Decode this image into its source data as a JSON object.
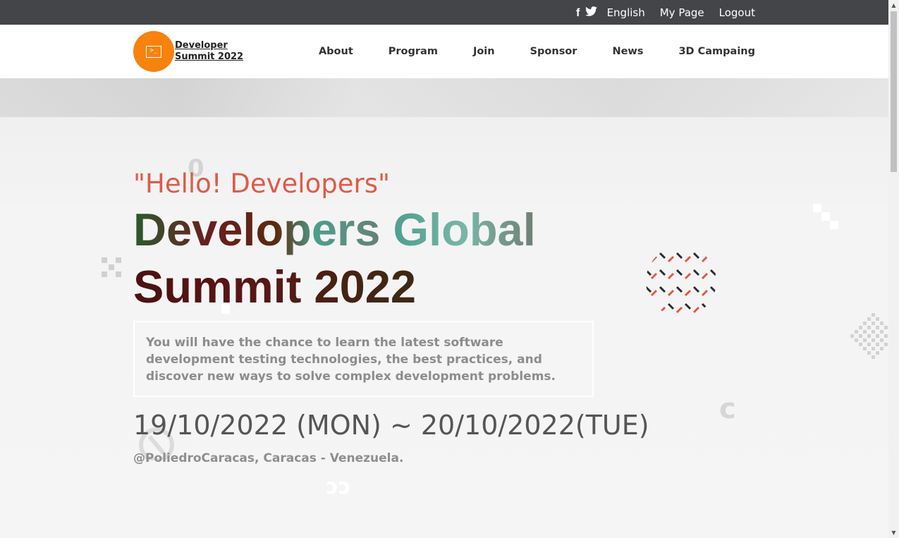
{
  "topbar": {
    "social_icons": [
      "facebook-icon",
      "twitter-icon"
    ],
    "facebook_glyph": "f",
    "twitter_glyph": "🐦",
    "links": [
      "English",
      "My Page",
      "Logout"
    ]
  },
  "nav": {
    "logo_text_line1": "Developer",
    "logo_text_line2": "Summit 2022",
    "logo_glyph": ">_",
    "menu": [
      "About",
      "Program",
      "Join",
      "Sponsor",
      "News",
      "3D Campaing"
    ]
  },
  "hero": {
    "hello": "\"Hello! Developers\"",
    "title_line1_part1": "Developers ",
    "title_line1_part2": "Global",
    "title_line2": "Summit 2022",
    "description": "You will have the chance to learn the latest software development testing technologies, the best practices, and discover new ways to solve complex development problems.",
    "dates": "19/10/2022 (MON) ~ 20/10/2022(TUE)",
    "venue": "@PoliedroCaracas, Caracas - Venezuela."
  },
  "colors": {
    "topbar_bg": "#444548",
    "logo_orange": "#f7820e",
    "hello_red": "#e05a4a"
  }
}
